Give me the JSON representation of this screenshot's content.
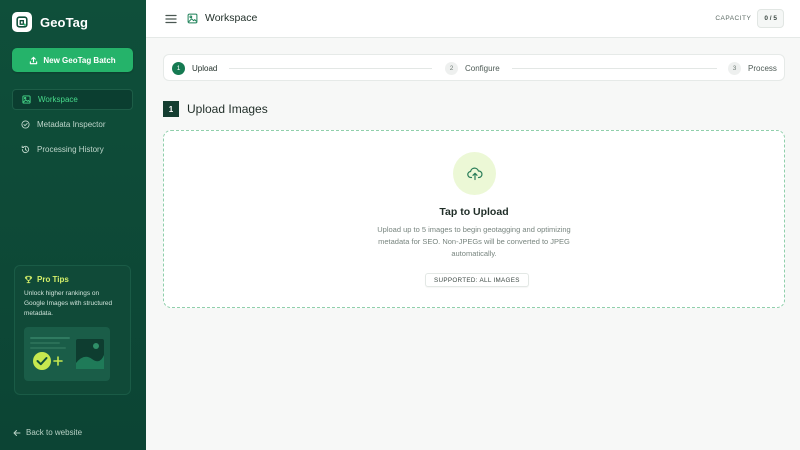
{
  "brand": {
    "name": "GeoTag"
  },
  "sidebar": {
    "new_batch_label": "New GeoTag Batch",
    "items": [
      {
        "label": "Workspace",
        "icon": "image-icon",
        "active": true
      },
      {
        "label": "Metadata Inspector",
        "icon": "check-circle-icon",
        "active": false
      },
      {
        "label": "Processing History",
        "icon": "history-icon",
        "active": false
      }
    ],
    "pro_tips": {
      "title": "Pro Tips",
      "text": "Unlock higher rankings on Google Images with structured metadata."
    },
    "back_label": "Back to website"
  },
  "header": {
    "title": "Workspace",
    "capacity_label": "CAPACITY",
    "capacity_value": "0 / 5"
  },
  "stepper": {
    "steps": [
      {
        "num": "1",
        "label": "Upload",
        "state": "active"
      },
      {
        "num": "2",
        "label": "Configure",
        "state": "pending"
      },
      {
        "num": "3",
        "label": "Process",
        "state": "pending"
      }
    ]
  },
  "section": {
    "num": "1",
    "title": "Upload Images"
  },
  "dropzone": {
    "title": "Tap to Upload",
    "description": "Upload up to 5 images to begin geotagging and optimizing metadata for SEO. Non-JPEGs will be converted to JPEG automatically.",
    "supported": "SUPPORTED: ALL IMAGES"
  },
  "colors": {
    "sidebar_bg": "#0f4f3a",
    "accent": "#25b36a",
    "active_step": "#167a52",
    "tip_highlight": "#d5f06a"
  }
}
